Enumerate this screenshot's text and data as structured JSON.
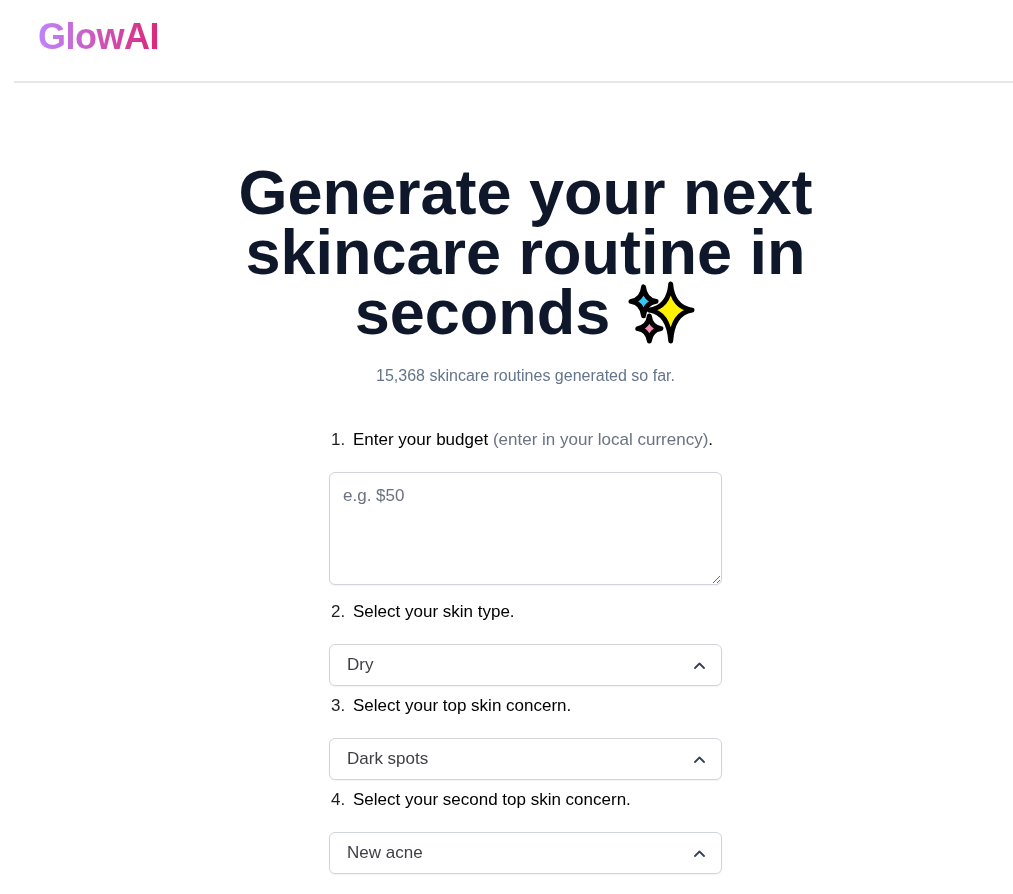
{
  "header": {
    "logo": "GlowAI"
  },
  "hero": {
    "title_lines": [
      "Generate your next",
      "skincare routine in",
      "seconds"
    ],
    "subtitle": "15,368 skincare routines generated so far."
  },
  "steps": [
    {
      "kind": "text",
      "number": "1.",
      "label": "Enter your budget",
      "hint": "(enter in your local currency)",
      "label_end": ".",
      "placeholder": "e.g. $50"
    },
    {
      "kind": "select",
      "number": "2.",
      "label": "Select your skin type.",
      "value": "Dry"
    },
    {
      "kind": "select",
      "number": "3.",
      "label": "Select your top skin concern.",
      "value": "Dark spots"
    },
    {
      "kind": "select",
      "number": "4.",
      "label": "Select your second top skin concern.",
      "value": "New acne"
    }
  ]
}
